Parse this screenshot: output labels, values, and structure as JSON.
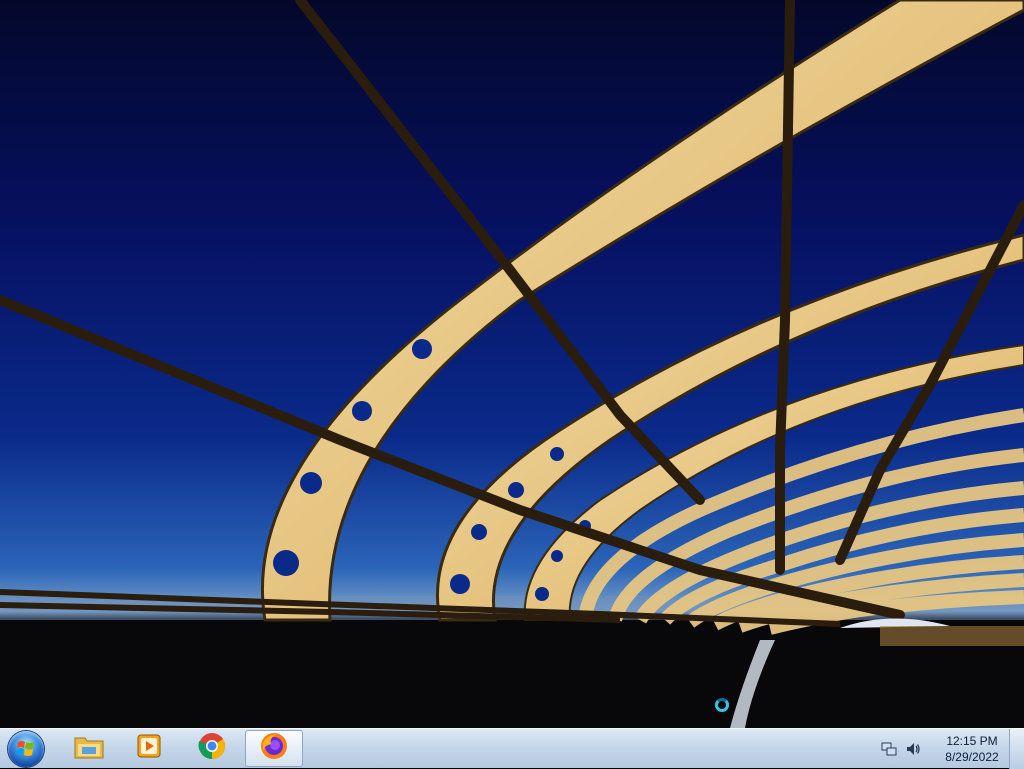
{
  "desktop": {
    "wallpaper_icon": "bridge-wallpaper"
  },
  "taskbar": {
    "start": {
      "icon": "windows-start-orb-icon"
    },
    "pinned": [
      {
        "name": "windows-explorer",
        "icon": "folder-icon",
        "active": false
      },
      {
        "name": "windows-media-player",
        "icon": "media-player-icon",
        "active": false
      },
      {
        "name": "google-chrome",
        "icon": "chrome-icon",
        "active": false
      },
      {
        "name": "firefox",
        "icon": "firefox-icon",
        "active": true
      }
    ],
    "tray": {
      "icons": [
        "network-icon",
        "volume-icon"
      ],
      "time": "12:15 PM",
      "date": "8/29/2022"
    }
  },
  "colors": {
    "sky_top": "#03082a",
    "sky_mid": "#0a2a8a",
    "arch": "#e8c784",
    "taskbar": "#c5d7ea"
  }
}
